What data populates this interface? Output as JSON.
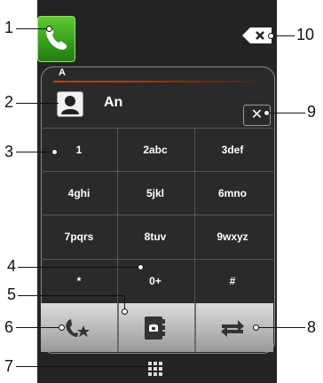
{
  "search": {
    "group_letter": "A",
    "contact_name": "An"
  },
  "keypad": {
    "keys": [
      "1",
      "2abc",
      "3def",
      "4ghi",
      "5jkl",
      "6mno",
      "7pqrs",
      "8tuv",
      "9wxyz",
      "*",
      "0+",
      "#"
    ]
  },
  "callouts": [
    "1",
    "2",
    "3",
    "4",
    "5",
    "6",
    "7",
    "8",
    "9",
    "10"
  ],
  "icons": {
    "call": "phone-handset-icon",
    "delete": "backspace-icon",
    "clear": "clear-x-icon",
    "favorites": "phone-star-icon",
    "contacts": "contacts-book-icon",
    "switch": "swap-arrows-icon",
    "keypad": "grid-icon"
  },
  "colors": {
    "call_green": "#3aa81f",
    "accent_red": "#d23b0c",
    "background": "#242424"
  }
}
